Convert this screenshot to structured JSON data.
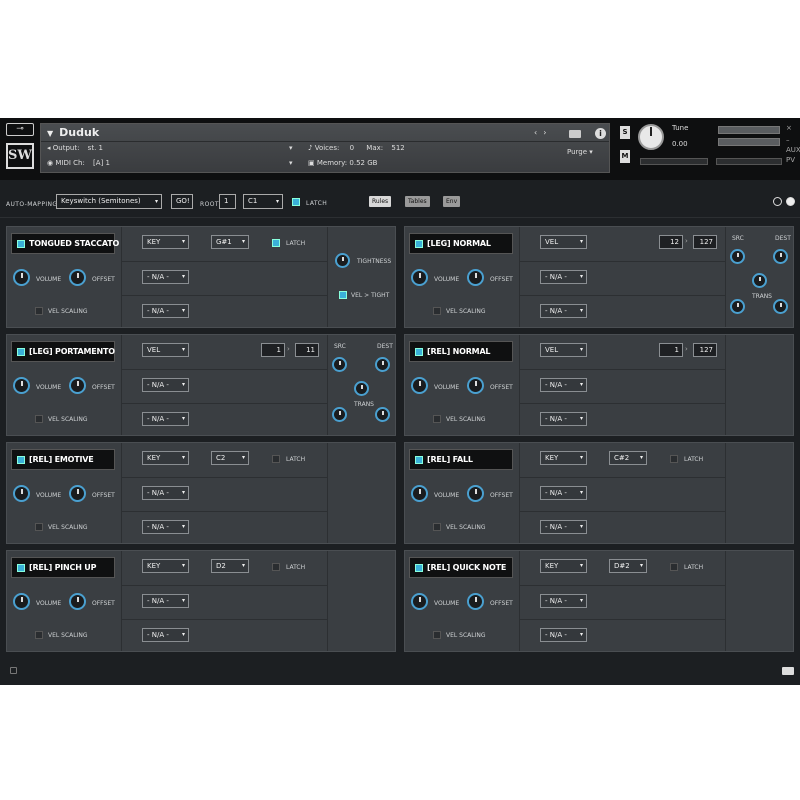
{
  "header": {
    "key_icon": "key-icon",
    "logo": "SW",
    "instrument": "Duduk",
    "output_label": "Output:",
    "output_value": "st. 1",
    "midi_label": "MIDI Ch:",
    "midi_value": "[A]  1",
    "voices_label": "Voices:",
    "voices_value": "0",
    "max_label": "Max:",
    "max_value": "512",
    "memory_label": "Memory:",
    "memory_value": "0.52 GB",
    "purge_label": "Purge",
    "info_label": "i",
    "s_label": "S",
    "m_label": "M",
    "tune_label": "Tune",
    "tune_value": "0.00",
    "aux_label": "AUX",
    "pv_label": "PV"
  },
  "toolbar": {
    "auto_mapping_label": "AUTO-MAPPING",
    "mode_value": "Keyswitch (Semitones)",
    "go_label": "GO!",
    "root_label": "ROOT",
    "root_value": "1",
    "note_value": "C1",
    "latch_label": "LATCH",
    "tabs": [
      "Rules",
      "Tables",
      "Env"
    ]
  },
  "common": {
    "volume_label": "VOLUME",
    "offset_label": "OFFSET",
    "vel_scaling_label": "VEL SCALING",
    "na_label": "- N/A -",
    "latch_label": "LATCH",
    "src_label": "SRC",
    "dest_label": "DEST",
    "trans_label": "TRANS",
    "tightness_label": "TIGHTNESS",
    "vel_tight_label": "VEL > TIGHT"
  },
  "panels": [
    {
      "name": "TONGUED STACCATO",
      "type": "KEY",
      "note": "G#1",
      "latch_on": true
    },
    {
      "name": "[LEG] NORMAL",
      "type": "VEL",
      "from": "12",
      "to": "127"
    },
    {
      "name": "[LEG] PORTAMENTO",
      "type": "VEL",
      "from": "1",
      "to": "11"
    },
    {
      "name": "[REL] NORMAL",
      "type": "VEL",
      "from": "1",
      "to": "127"
    },
    {
      "name": "[REL] EMOTIVE",
      "type": "KEY",
      "note": "C2",
      "latch_on": false
    },
    {
      "name": "[REL] FALL",
      "type": "KEY",
      "note": "C#2",
      "latch_on": false
    },
    {
      "name": "[REL] PINCH UP",
      "type": "KEY",
      "note": "D2",
      "latch_on": false
    },
    {
      "name": "[REL] QUICK NOTE",
      "type": "KEY",
      "note": "D#2",
      "latch_on": false
    }
  ],
  "colors": {
    "accent": "#3ab0d8",
    "panel_bg": "#3a3e42",
    "app_bg": "#1c1f22"
  }
}
